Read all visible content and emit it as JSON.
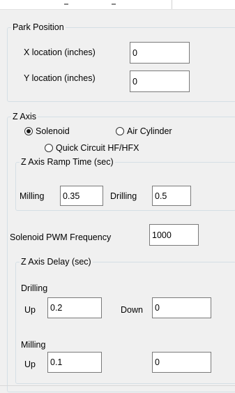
{
  "park_position": {
    "title": "Park Position",
    "x_label": "X location (inches)",
    "x_value": "0",
    "y_label": "Y location (inches)",
    "y_value": "0"
  },
  "z_axis": {
    "title": "Z Axis",
    "modes": [
      {
        "label": "Solenoid",
        "selected": true
      },
      {
        "label": "Air Cylinder",
        "selected": false
      },
      {
        "label": "Quick Circuit HF/HFX",
        "selected": false
      }
    ],
    "ramp_time": {
      "title": "Z Axis Ramp Time (sec)",
      "milling_label": "Milling",
      "milling_value": "0.35",
      "drilling_label": "Drilling",
      "drilling_value": "0.5"
    },
    "pwm": {
      "label": "Solenoid PWM Frequency",
      "value": "1000"
    },
    "delay": {
      "title": "Z Axis Delay (sec)",
      "drilling_label": "Drilling",
      "drilling_up_label": "Up",
      "drilling_up_value": "0.2",
      "drilling_down_label": "Down",
      "drilling_down_value": "0",
      "milling_label": "Milling",
      "milling_up_label": "Up",
      "milling_up_value": "0.1",
      "milling_down_value": "0"
    }
  }
}
